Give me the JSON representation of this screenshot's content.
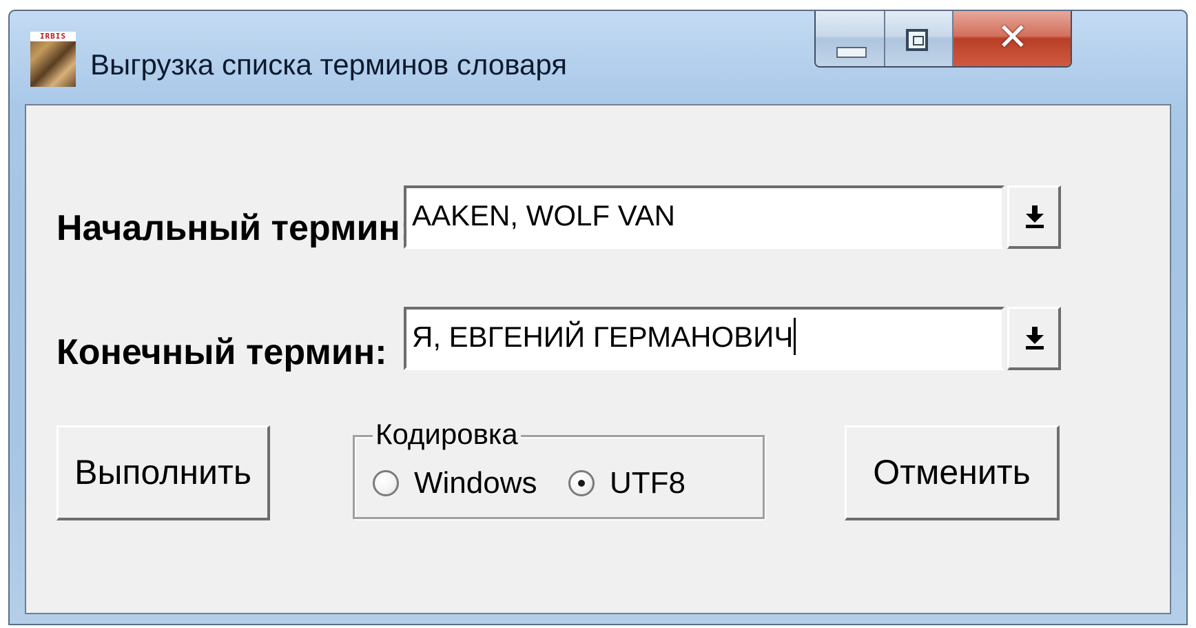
{
  "window": {
    "title": "Выгрузка списка терминов словаря",
    "icon": "irbis-leopard-icon",
    "icon_text": "IRBIS"
  },
  "caption_buttons": {
    "minimize_icon": "minimize-icon",
    "maximize_icon": "maximize-icon",
    "close_icon": "close-icon",
    "close_glyph": "✕",
    "close_color": "#c8462b"
  },
  "form": {
    "start_term": {
      "label": "Начальный термин:",
      "value": "AAKEN, WOLF VAN",
      "dropdown_icon": "down-arrow-icon"
    },
    "end_term": {
      "label": "Конечный термин:",
      "value": "Я, ЕВГЕНИЙ ГЕРМАНОВИЧ",
      "dropdown_icon": "down-arrow-icon"
    },
    "encoding": {
      "legend": "Кодировка",
      "options": [
        {
          "label": "Windows",
          "selected": false
        },
        {
          "label": "UTF8",
          "selected": true
        }
      ]
    },
    "run_button": "Выполнить",
    "cancel_button": "Отменить"
  }
}
